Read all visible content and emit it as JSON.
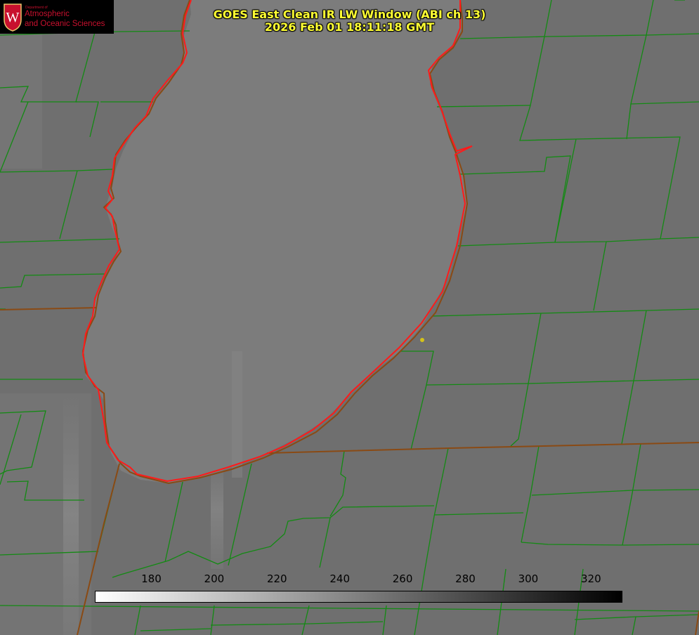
{
  "header": {
    "title_line1": "GOES East Clean IR LW Window (ABI ch 13)",
    "title_line2": "2026 Feb 01 18:11:18 GMT"
  },
  "logo": {
    "department_label": "Department of",
    "line1": "Atmospheric",
    "line2": "and Oceanic Sciences",
    "seal_letter": "W"
  },
  "colorbar": {
    "ticks": [
      "180",
      "200",
      "220",
      "240",
      "260",
      "280",
      "300",
      "320"
    ],
    "range": [
      162,
      330
    ],
    "gradient": [
      "#ffffff",
      "#000000"
    ]
  },
  "colors": {
    "background": "#6e6e6e",
    "lake": "#7a7a7a",
    "county_lines": "#138a13",
    "coastline": "#ff1a1a",
    "state_border": "#8a4a14",
    "title": "#ffff33",
    "marker": "#d4c21a"
  }
}
